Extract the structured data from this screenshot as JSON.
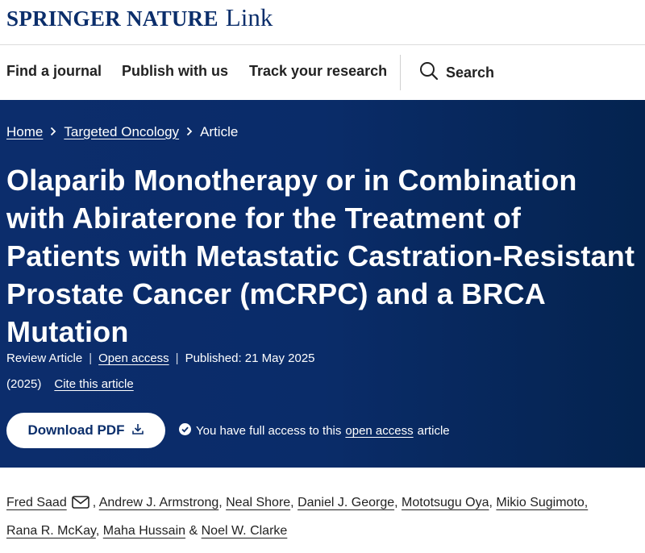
{
  "brand": {
    "name": "SPRINGER NATURE",
    "suffix": "Link"
  },
  "nav": {
    "items": [
      "Find a journal",
      "Publish with us",
      "Track your research"
    ],
    "search_label": "Search"
  },
  "breadcrumb": {
    "home": "Home",
    "journal": "Targeted Oncology",
    "current": "Article"
  },
  "article": {
    "title": "Olaparib Monotherapy or in Combination with Abiraterone for the Treatment of Patients with Metastatic Castration-Resistant Prostate Cancer (mCRPC) and a BRCA Mutation",
    "type": "Review Article",
    "access": "Open access",
    "published": "Published: 21 May 2025",
    "year": "(2025)",
    "cite": "Cite this article"
  },
  "download": {
    "label": "Download PDF"
  },
  "access_note": {
    "prefix": "You have full access to this",
    "link": "open access",
    "suffix": "article"
  },
  "authors": {
    "line1": [
      "Fred Saad",
      "Andrew J. Armstrong",
      "Neal Shore",
      "Daniel J. George",
      "Mototsugu Oya",
      "Mikio Sugimoto,"
    ],
    "line2": [
      "Rana R. McKay",
      "Maha Hussain",
      "Noel W. Clarke"
    ],
    "and": "&"
  },
  "colors": {
    "hero": "#0a2c69",
    "brand": "#0b2e6b"
  },
  "icons": [
    "search-icon",
    "chevron-right-icon",
    "download-icon",
    "check-circle-icon",
    "mail-icon"
  ]
}
